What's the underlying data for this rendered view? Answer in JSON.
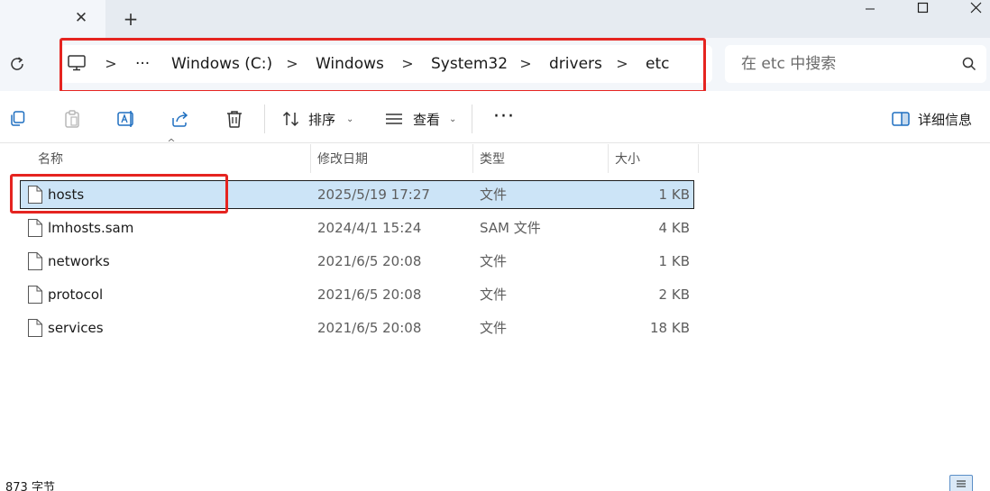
{
  "tab": {
    "close_glyph": "✕",
    "new_glyph": "+"
  },
  "window_controls": [
    "minimize-icon",
    "maximize-icon",
    "close-icon"
  ],
  "breadcrumb": {
    "root_icon": "computer-icon",
    "overflow": "···",
    "separator": ">",
    "items": [
      "Windows (C:)",
      "Windows",
      "System32",
      "drivers",
      "etc"
    ]
  },
  "search": {
    "placeholder": "在 etc 中搜索",
    "icon": "search-icon"
  },
  "toolbar": {
    "copy_icon": "copy-icon",
    "paste_icon": "paste-icon",
    "rename_icon": "rename-icon",
    "share_icon": "share-icon",
    "delete_icon": "delete-icon",
    "sort_label": "排序",
    "view_label": "查看",
    "more_glyph": "···",
    "details_label": "详细信息"
  },
  "columns": {
    "name": "名称",
    "date": "修改日期",
    "type": "类型",
    "size": "大小"
  },
  "files": [
    {
      "name": "hosts",
      "date": "2025/5/19 17:27",
      "type": "文件",
      "size": "1 KB",
      "selected": true
    },
    {
      "name": "lmhosts.sam",
      "date": "2024/4/1 15:24",
      "type": "SAM 文件",
      "size": "4 KB",
      "selected": false
    },
    {
      "name": "networks",
      "date": "2021/6/5 20:08",
      "type": "文件",
      "size": "1 KB",
      "selected": false
    },
    {
      "name": "protocol",
      "date": "2021/6/5 20:08",
      "type": "文件",
      "size": "2 KB",
      "selected": false
    },
    {
      "name": "services",
      "date": "2021/6/5 20:08",
      "type": "文件",
      "size": "18 KB",
      "selected": false
    }
  ],
  "status": {
    "text": "873 字节"
  },
  "colors": {
    "accent": "#e52420",
    "selection": "#cce4f7",
    "titlebar": "#e6ebf1",
    "navrow": "#f3f6fa"
  }
}
